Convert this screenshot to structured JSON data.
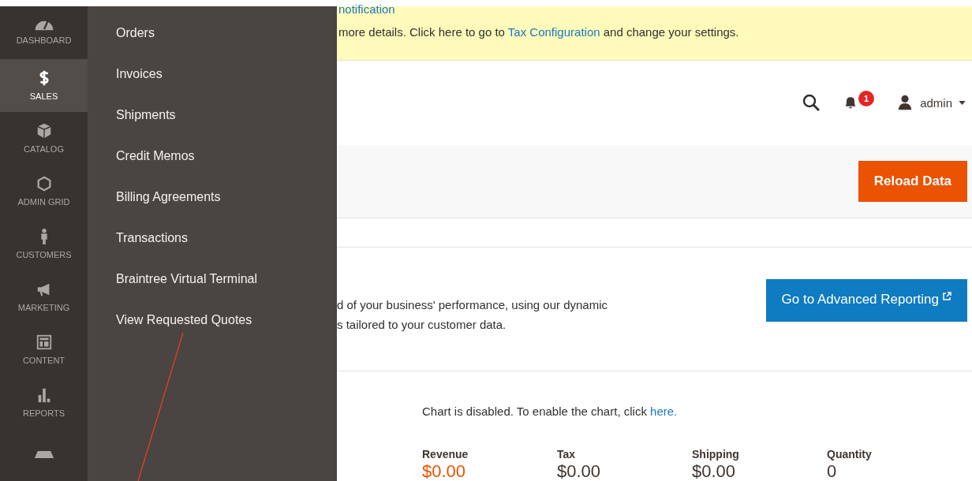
{
  "sidebar": {
    "items": [
      {
        "label": "DASHBOARD",
        "selected": false
      },
      {
        "label": "SALES",
        "selected": true
      },
      {
        "label": "CATALOG",
        "selected": false
      },
      {
        "label": "ADMIN GRID",
        "selected": false
      },
      {
        "label": "CUSTOMERS",
        "selected": false
      },
      {
        "label": "MARKETING",
        "selected": false
      },
      {
        "label": "CONTENT",
        "selected": false
      },
      {
        "label": "REPORTS",
        "selected": false
      },
      {
        "selected": false
      }
    ]
  },
  "submenu": {
    "items": [
      "Orders",
      "Invoices",
      "Shipments",
      "Credit Memos",
      "Billing Agreements",
      "Transactions",
      "Braintree Virtual Terminal",
      "View Requested Quotes"
    ]
  },
  "notice": {
    "link": "notification",
    "before": "more details. Click here to go to ",
    "link2": "Tax Configuration",
    "after": " and change your settings."
  },
  "header": {
    "notifications": "1",
    "user": "admin"
  },
  "actions": {
    "reload": "Reload Data"
  },
  "reporting": {
    "line1": "d of your business' performance, using our dynamic",
    "line2": "s tailored to your customer data.",
    "button": "Go to Advanced Reporting"
  },
  "chart": {
    "message": "Chart is disabled. To enable the chart, click ",
    "link": "here."
  },
  "totals": [
    {
      "label": "Revenue",
      "value": "$0.00",
      "highlight": true
    },
    {
      "label": "Tax",
      "value": "$0.00",
      "highlight": false
    },
    {
      "label": "Shipping",
      "value": "$0.00",
      "highlight": false
    },
    {
      "label": "Quantity",
      "value": "0",
      "highlight": false
    }
  ]
}
